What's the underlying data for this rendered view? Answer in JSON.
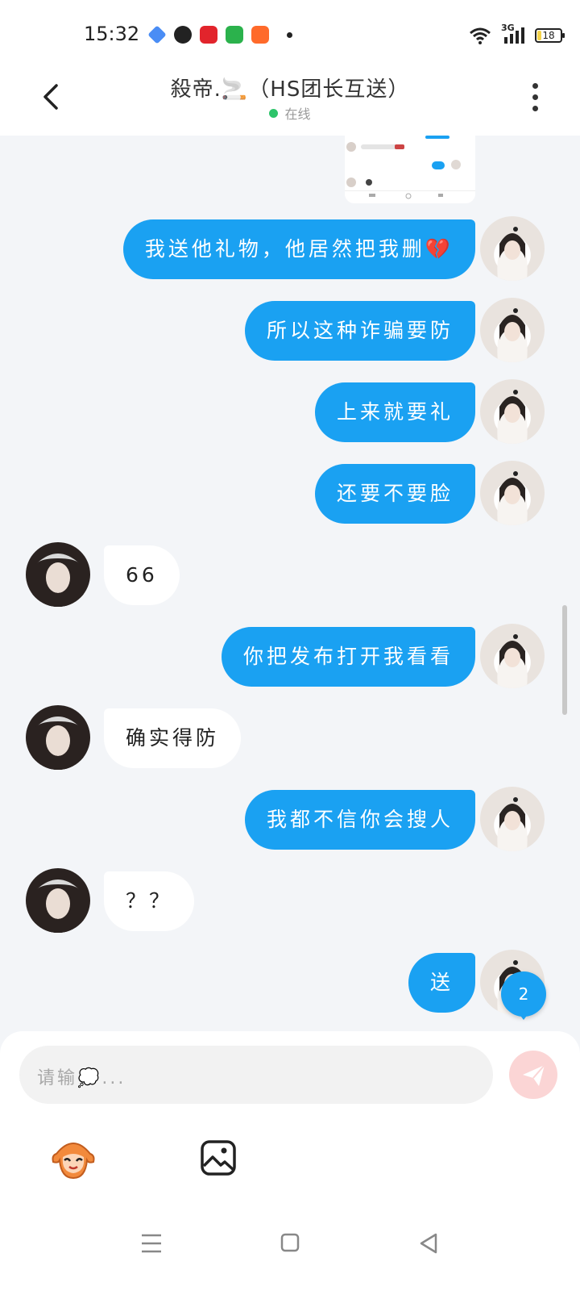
{
  "status_bar": {
    "time": "15:32",
    "network": "3G",
    "battery": "18"
  },
  "header": {
    "title": "殺帝.🚬（HS团长互送）",
    "status": "在线"
  },
  "messages": [
    {
      "from": "me",
      "text": "我送他礼物，他居然把我删💔"
    },
    {
      "from": "me",
      "text": "所以这种诈骗要防"
    },
    {
      "from": "me",
      "text": "上来就要礼"
    },
    {
      "from": "me",
      "text": "还要不要脸"
    },
    {
      "from": "them",
      "text": "66"
    },
    {
      "from": "me",
      "text": "你把发布打开我看看"
    },
    {
      "from": "them",
      "text": "确实得防"
    },
    {
      "from": "me",
      "text": "我都不信你会搜人"
    },
    {
      "from": "them",
      "text": "？？"
    },
    {
      "from": "me",
      "text": "送"
    }
  ],
  "unread_count": "2",
  "composer": {
    "placeholder": "请输💭..."
  },
  "icons": {
    "back": "chevron-left-icon",
    "menu": "more-vertical-icon",
    "send": "send-icon",
    "emoji": "monkey-emoji-icon",
    "image": "image-icon"
  },
  "colors": {
    "accent": "#1aa1f2",
    "background": "#f3f5f8",
    "online": "#2dc46a"
  }
}
